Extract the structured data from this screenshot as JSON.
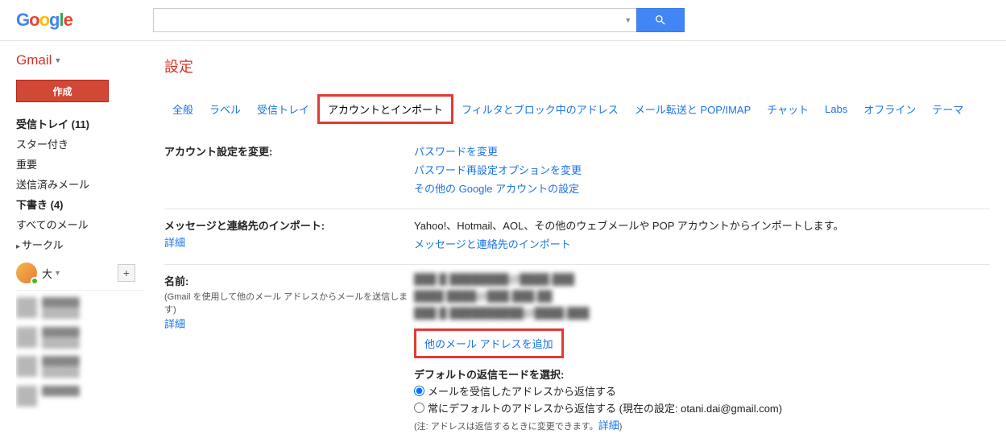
{
  "app": {
    "logo": "Google",
    "gmail_label": "Gmail"
  },
  "search": {
    "placeholder": ""
  },
  "sidebar": {
    "compose": "作成",
    "items": [
      {
        "label": "受信トレイ (11)",
        "bold": true
      },
      {
        "label": "スター付き"
      },
      {
        "label": "重要"
      },
      {
        "label": "送信済みメール"
      },
      {
        "label": "下書き (4)",
        "bold": true
      },
      {
        "label": "すべてのメール"
      },
      {
        "label": "サークル",
        "arrow": true
      }
    ],
    "chat_user": "大"
  },
  "page_title": "設定",
  "tabs": [
    "全般",
    "ラベル",
    "受信トレイ",
    "アカウントとインポート",
    "フィルタとブロック中のアドレス",
    "メール転送と POP/IMAP",
    "チャット",
    "Labs",
    "オフライン",
    "テーマ"
  ],
  "active_tab_index": 3,
  "sections": {
    "account_change": {
      "title": "アカウント設定を変更:",
      "pw": "パスワードを変更",
      "pw_reset": "パスワード再設定オプションを変更",
      "other": "その他の Google アカウントの設定"
    },
    "import": {
      "title": "メッセージと連絡先のインポート:",
      "detail": "詳細",
      "desc": "Yahoo!、Hotmail、AOL、その他のウェブメールや POP アカウントからインポートします。",
      "link": "メッセージと連絡先のインポート"
    },
    "name": {
      "title": "名前:",
      "sub": "(Gmail を使用して他のメール アドレスからメールを送信します)",
      "detail": "詳細",
      "add_link": "他のメール アドレスを追加",
      "default_mode": "デフォルトの返信モードを選択:",
      "opt1": "メールを受信したアドレスから返信する",
      "opt2_prefix": "常にデフォルトのアドレスから返信する (現在の設定: otani.dai@gmail.com)",
      "note_prefix": "(注: アドレスは返信するときに変更できます。",
      "note_link": "詳細",
      "note_suffix": ")"
    }
  }
}
